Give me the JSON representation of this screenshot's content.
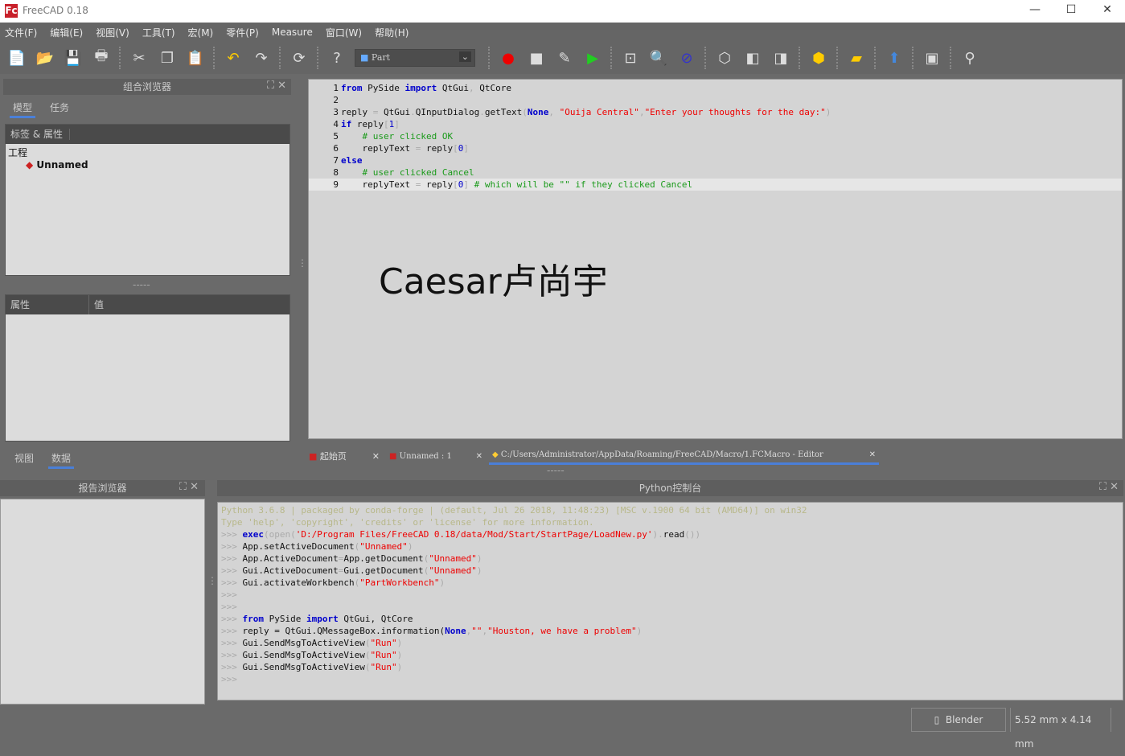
{
  "window": {
    "title": "FreeCAD 0.18",
    "logo": "Fc"
  },
  "menu": [
    "文件(F)",
    "编辑(E)",
    "视图(V)",
    "工具(T)",
    "宏(M)",
    "零件(P)",
    "Measure",
    "窗口(W)",
    "帮助(H)"
  ],
  "toolbar": {
    "workbench": "Part",
    "icons": [
      "new-icon",
      "open-icon",
      "save-icon",
      "print-icon",
      "cut-icon",
      "copy-icon",
      "paste-icon",
      "undo-icon",
      "redo-icon",
      "refresh-icon",
      "whats-this-icon",
      "record-macro-icon",
      "stop-macro-icon",
      "edit-macro-icon",
      "run-macro-icon",
      "fit-all-icon",
      "zoom-selection-icon",
      "draw-style-icon",
      "isometric-icon",
      "front-view-icon",
      "top-view-icon",
      "part-icon",
      "box-icon",
      "extrude-icon",
      "measure-icon",
      "snap-icon"
    ]
  },
  "combo_view": {
    "title": "组合浏览器",
    "tabs": [
      "模型",
      "任务"
    ],
    "tree_header": "标签 & 属性",
    "root": "工程",
    "document": "Unnamed",
    "prop_headers": [
      "属性",
      "值"
    ],
    "bottom_tabs": [
      "视图",
      "数据"
    ]
  },
  "editor": {
    "lines": [
      [
        [
          "from",
          "kw"
        ],
        [
          " PySide ",
          ""
        ],
        [
          "import",
          "kw"
        ],
        [
          " QtGui",
          ""
        ],
        [
          ", ",
          "pr"
        ],
        [
          "QtCore",
          ""
        ]
      ],
      [],
      [
        [
          "reply ",
          ""
        ],
        [
          "= ",
          "pr"
        ],
        [
          "QtGui",
          ""
        ],
        [
          ".",
          "pr"
        ],
        [
          "QInputDialog",
          ""
        ],
        [
          ".",
          "pr"
        ],
        [
          "getText",
          ""
        ],
        [
          "(",
          "pr"
        ],
        [
          "None",
          "kw"
        ],
        [
          ", ",
          "pr"
        ],
        [
          "\"Ouija Central\"",
          "str"
        ],
        [
          ",",
          "pr"
        ],
        [
          "\"Enter your thoughts for the day:\"",
          "str"
        ],
        [
          ")",
          "pr"
        ]
      ],
      [
        [
          "if",
          "kw"
        ],
        [
          " reply",
          ""
        ],
        [
          "[",
          "pr"
        ],
        [
          "1",
          "num"
        ],
        [
          "]",
          "pr"
        ]
      ],
      [
        [
          "    # user clicked OK",
          "com"
        ]
      ],
      [
        [
          "    replyText ",
          ""
        ],
        [
          "= ",
          "pr"
        ],
        [
          "reply",
          ""
        ],
        [
          "[",
          "pr"
        ],
        [
          "0",
          "num"
        ],
        [
          "]",
          "pr"
        ]
      ],
      [
        [
          "else",
          "kw"
        ]
      ],
      [
        [
          "    # user clicked Cancel",
          "com"
        ]
      ],
      [
        [
          "    replyText ",
          ""
        ],
        [
          "= ",
          "pr"
        ],
        [
          "reply",
          ""
        ],
        [
          "[",
          "pr"
        ],
        [
          "0",
          "num"
        ],
        [
          "] ",
          "pr"
        ],
        [
          "# which will be \"\" if they clicked Cancel",
          "com"
        ]
      ]
    ],
    "watermark": "Caesar卢尚宇"
  },
  "doc_tabs": [
    "起始页",
    "Unnamed : 1",
    "C:/Users/Administrator/AppData/Roaming/FreeCAD/Macro/1.FCMacro - Editor"
  ],
  "report": {
    "title": "报告浏览器"
  },
  "console": {
    "title": "Python控制台",
    "lines": [
      [
        [
          "Python 3.6.8 | packaged by conda-forge | (default, Jul 26 2018, 11:48:23) [MSC v.1900 64 bit (AMD64)] on win32",
          "ban"
        ]
      ],
      [
        [
          "Type 'help', 'copyright', 'credits' or 'license' for more information.",
          "ban"
        ]
      ],
      [
        [
          ">>> ",
          "bn"
        ],
        [
          "exec",
          "kw"
        ],
        [
          "(open(",
          "pr"
        ],
        [
          "'D:/Program Files/FreeCAD 0.18/data/Mod/Start/StartPage/LoadNew.py'",
          "str"
        ],
        [
          ").",
          "pr"
        ],
        [
          "read",
          ""
        ],
        [
          "())",
          "pr"
        ]
      ],
      [
        [
          ">>> ",
          "bn"
        ],
        [
          "App.setActiveDocument",
          ""
        ],
        [
          "(",
          "pr"
        ],
        [
          "\"Unnamed\"",
          "str"
        ],
        [
          ")",
          "pr"
        ]
      ],
      [
        [
          ">>> ",
          "bn"
        ],
        [
          "App.ActiveDocument",
          ""
        ],
        [
          "=",
          "pr"
        ],
        [
          "App.getDocument",
          ""
        ],
        [
          "(",
          "pr"
        ],
        [
          "\"Unnamed\"",
          "str"
        ],
        [
          ")",
          "pr"
        ]
      ],
      [
        [
          ">>> ",
          "bn"
        ],
        [
          "Gui.ActiveDocument",
          ""
        ],
        [
          "=",
          "pr"
        ],
        [
          "Gui.getDocument",
          ""
        ],
        [
          "(",
          "pr"
        ],
        [
          "\"Unnamed\"",
          "str"
        ],
        [
          ")",
          "pr"
        ]
      ],
      [
        [
          ">>> ",
          "bn"
        ],
        [
          "Gui.activateWorkbench",
          ""
        ],
        [
          "(",
          "pr"
        ],
        [
          "\"PartWorkbench\"",
          "str"
        ],
        [
          ")",
          "pr"
        ]
      ],
      [
        [
          ">>> ",
          "bn"
        ]
      ],
      [
        [
          ">>> ",
          "bn"
        ]
      ],
      [
        [
          ">>> ",
          "bn"
        ],
        [
          "from",
          "kw"
        ],
        [
          " PySide ",
          ""
        ],
        [
          "import",
          "kw"
        ],
        [
          " QtGui, QtCore",
          ""
        ]
      ],
      [
        [
          ">>> ",
          "bn"
        ],
        [
          "reply = QtGui.QMessageBox.information(",
          ""
        ],
        [
          "None",
          "kw"
        ],
        [
          ",",
          "pr"
        ],
        [
          "\"\"",
          "str"
        ],
        [
          ",",
          "pr"
        ],
        [
          "\"Houston, we have a problem\"",
          "str"
        ],
        [
          ")",
          "pr"
        ]
      ],
      [
        [
          ">>> ",
          "bn"
        ],
        [
          "Gui.SendMsgToActiveView",
          ""
        ],
        [
          "(",
          "pr"
        ],
        [
          "\"Run\"",
          "str"
        ],
        [
          ")",
          "pr"
        ]
      ],
      [
        [
          ">>> ",
          "bn"
        ],
        [
          "Gui.SendMsgToActiveView",
          ""
        ],
        [
          "(",
          "pr"
        ],
        [
          "\"Run\"",
          "str"
        ],
        [
          ")",
          "pr"
        ]
      ],
      [
        [
          ">>> ",
          "bn"
        ],
        [
          "Gui.SendMsgToActiveView",
          ""
        ],
        [
          "(",
          "pr"
        ],
        [
          "\"Run\"",
          "str"
        ],
        [
          ")",
          "pr"
        ]
      ],
      [
        [
          ">>> ",
          "bn"
        ]
      ]
    ]
  },
  "status": {
    "nav_style": "Blender",
    "dimensions": "5.52 mm x 4.14 mm"
  }
}
